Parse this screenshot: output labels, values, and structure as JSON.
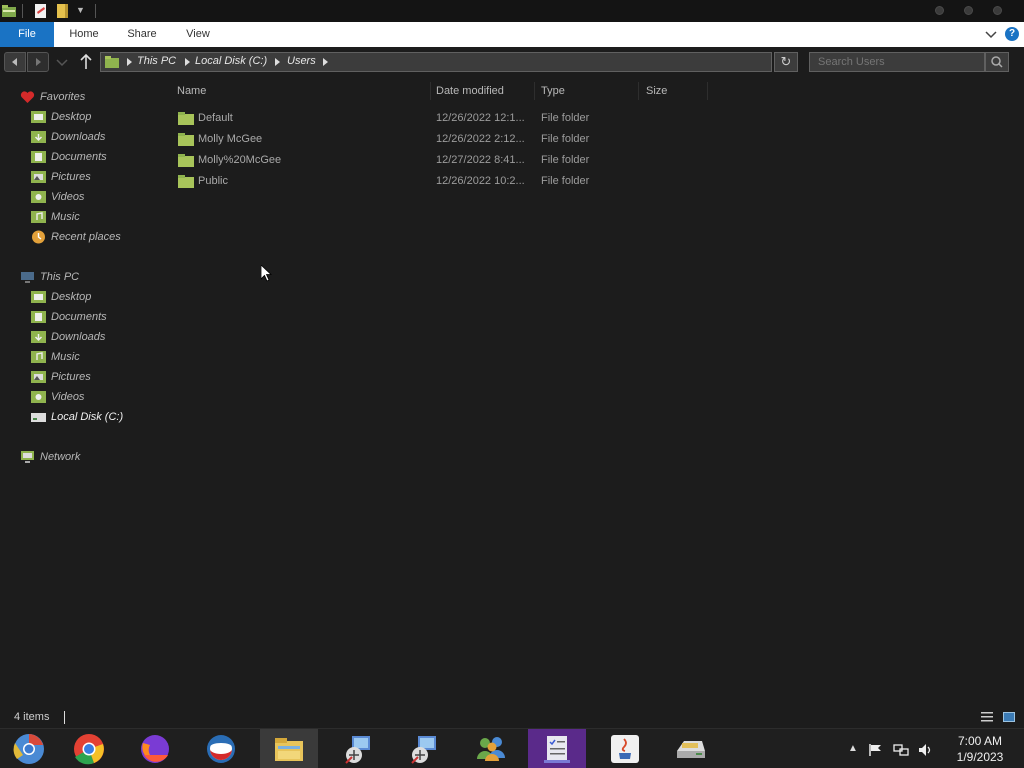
{
  "ribbon": {
    "tabs": [
      "File",
      "Home",
      "Share",
      "View"
    ]
  },
  "address": {
    "crumbs": [
      "This PC",
      "Local Disk (C:)",
      "Users"
    ]
  },
  "search": {
    "placeholder": "Search Users"
  },
  "nav": {
    "favorites": {
      "label": "Favorites",
      "items": [
        "Desktop",
        "Downloads",
        "Documents",
        "Pictures",
        "Videos",
        "Music",
        "Recent places"
      ]
    },
    "this_pc": {
      "label": "This PC",
      "items": [
        "Desktop",
        "Documents",
        "Downloads",
        "Music",
        "Pictures",
        "Videos",
        "Local Disk (C:)"
      ]
    },
    "network": {
      "label": "Network"
    }
  },
  "columns": [
    "Name",
    "Date modified",
    "Type",
    "Size"
  ],
  "files": [
    {
      "name": "Default",
      "date": "12/26/2022 12:1...",
      "type": "File folder",
      "size": ""
    },
    {
      "name": "Molly McGee",
      "date": "12/26/2022 2:12...",
      "type": "File folder",
      "size": ""
    },
    {
      "name": "Molly%20McGee",
      "date": "12/27/2022 8:41...",
      "type": "File folder",
      "size": ""
    },
    {
      "name": "Public",
      "date": "12/26/2022 10:2...",
      "type": "File folder",
      "size": ""
    }
  ],
  "status": {
    "items": "4 items"
  },
  "clock": {
    "time": "7:00 AM",
    "date": "1/9/2023"
  },
  "taskbar": {
    "apps": [
      "chromium-icon",
      "chrome-icon",
      "firefox-icon",
      "opera-icon",
      "file-explorer-icon",
      "network-setup-icon",
      "network-setup-icon-2",
      "users-icon",
      "checklist-app-icon",
      "java-icon",
      "drive-icon"
    ]
  },
  "colors": {
    "accent": "#1a73c4",
    "folder": "#a8c45a",
    "background": "#1c1c1c"
  }
}
